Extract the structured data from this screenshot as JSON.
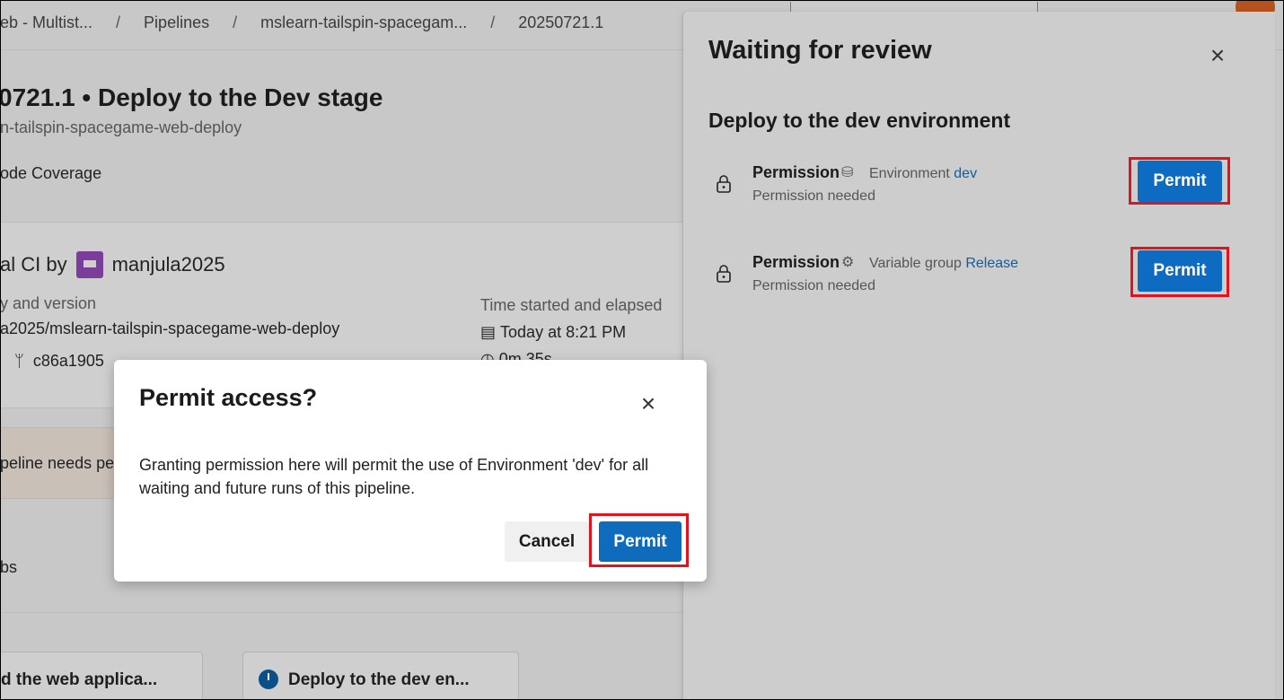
{
  "breadcrumb": {
    "items": [
      "eb - Multist...",
      "Pipelines",
      "mslearn-tailspin-spacegam...",
      "20250721.1"
    ],
    "separator": "/"
  },
  "run": {
    "title": "0721.1 • Deploy to the Dev stage",
    "repo_name": "n-tailspin-spacegame-web-deploy",
    "tab": "ode Coverage",
    "trigger_prefix": "al CI by",
    "user": "manjula2025",
    "repo_label": "y and version",
    "repo_value": "a2025/mslearn-tailspin-spacegame-web-deploy",
    "commit": "c86a1905",
    "time_label": "Time started and elapsed",
    "time_started": "Today at 8:21 PM",
    "time_elapsed": "0m 35s",
    "banner_text": "peline needs pe",
    "jobs_text": "bs",
    "stages": [
      "d the web applica...",
      "Deploy to the dev en..."
    ]
  },
  "panel": {
    "title": "Waiting for review",
    "close_icon": "close-icon",
    "subtitle": "Deploy to the dev environment",
    "permissions": [
      {
        "title": "Permission",
        "resource_icon": "environment-icon",
        "resource_type": "Environment",
        "resource_name": "dev",
        "status": "Permission needed",
        "button_label": "Permit"
      },
      {
        "title": "Permission",
        "resource_icon": "variable-group-icon",
        "resource_type": "Variable group",
        "resource_name": "Release",
        "status": "Permission needed",
        "button_label": "Permit"
      }
    ]
  },
  "modal": {
    "title": "Permit access?",
    "body": "Granting permission here will permit the use of Environment 'dev' for all waiting and future runs of this pipeline.",
    "cancel_label": "Cancel",
    "permit_label": "Permit"
  },
  "colors": {
    "primary": "#0f6cbd",
    "highlight": "#e0141e",
    "link": "#0b5ea8",
    "avatar": "#b5521e"
  }
}
